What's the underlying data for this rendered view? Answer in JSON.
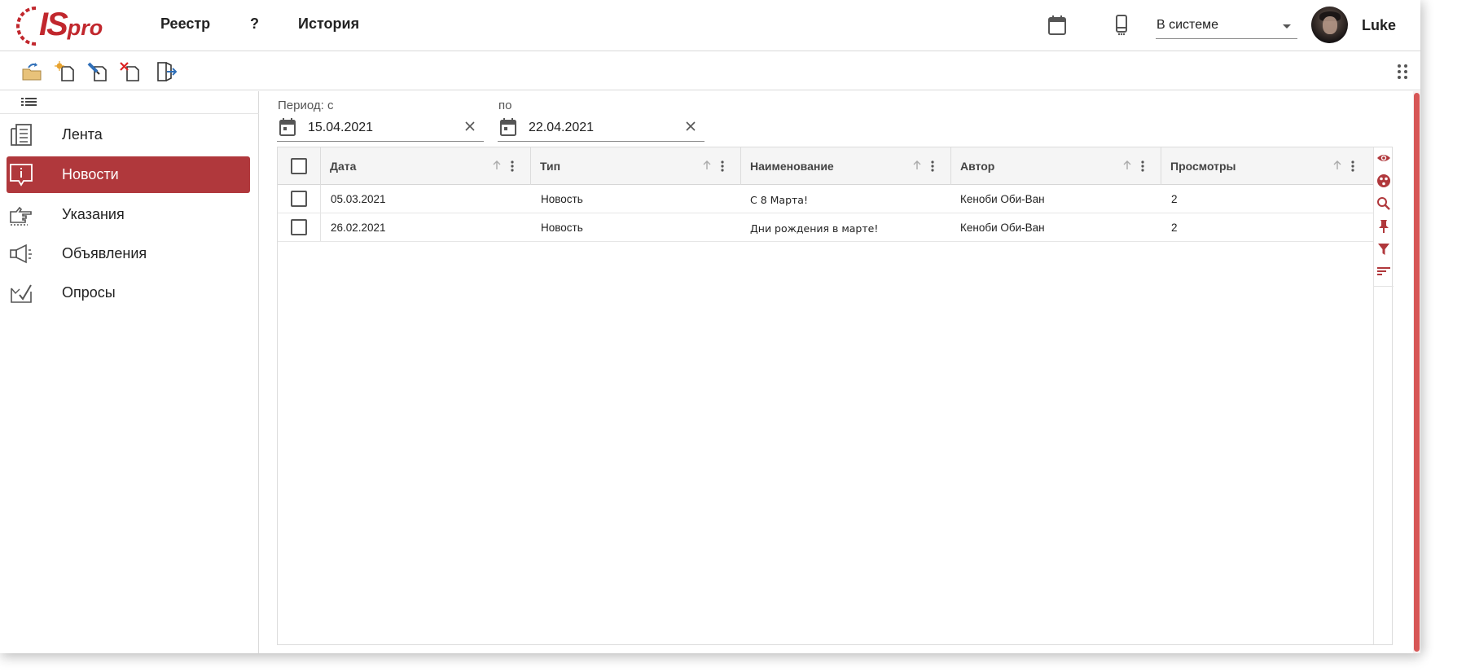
{
  "colors": {
    "brand": "#c1272d",
    "active_nav": "#b0383c",
    "scroll_thumb": "#d75656"
  },
  "header": {
    "logo": {
      "is": "IS",
      "pro": "pro"
    },
    "menu": [
      "Реестр",
      "?",
      "История"
    ],
    "icons": [
      "calendar-icon",
      "mobile-phone-icon"
    ],
    "status": {
      "value": "В системе"
    },
    "user": {
      "name": "Luke"
    }
  },
  "toolbar": {
    "buttons": [
      "open-folder-icon",
      "create-document-icon",
      "edit-document-icon",
      "delete-document-icon",
      "exit-icon"
    ],
    "more": "more-grid-icon"
  },
  "sidebar": {
    "items": [
      {
        "label": "Лента",
        "icon": "feed-icon",
        "active": false
      },
      {
        "label": "Новости",
        "icon": "news-icon",
        "active": true
      },
      {
        "label": "Указания",
        "icon": "pointing-hand-icon",
        "active": false
      },
      {
        "label": "Объявления",
        "icon": "megaphone-icon",
        "active": false
      },
      {
        "label": "Опросы",
        "icon": "survey-icon",
        "active": false
      }
    ]
  },
  "filter": {
    "from_label": "Период: с",
    "to_label": "по",
    "from_value": "15.04.2021",
    "to_value": "22.04.2021"
  },
  "table": {
    "columns": [
      "Дата",
      "Тип",
      "Наименование",
      "Автор",
      "Просмотры"
    ],
    "rows": [
      [
        "05.03.2021",
        "Новость",
        "С 8 Марта!",
        "Кеноби Оби-Ван",
        "2"
      ],
      [
        "26.02.2021",
        "Новость",
        "Дни рождения в марте!",
        "Кеноби Оби-Ван",
        "2"
      ]
    ]
  },
  "side_tools": [
    "eye-icon",
    "columns-icon",
    "search-icon",
    "pin-icon",
    "filter-icon",
    "sort-icon"
  ]
}
